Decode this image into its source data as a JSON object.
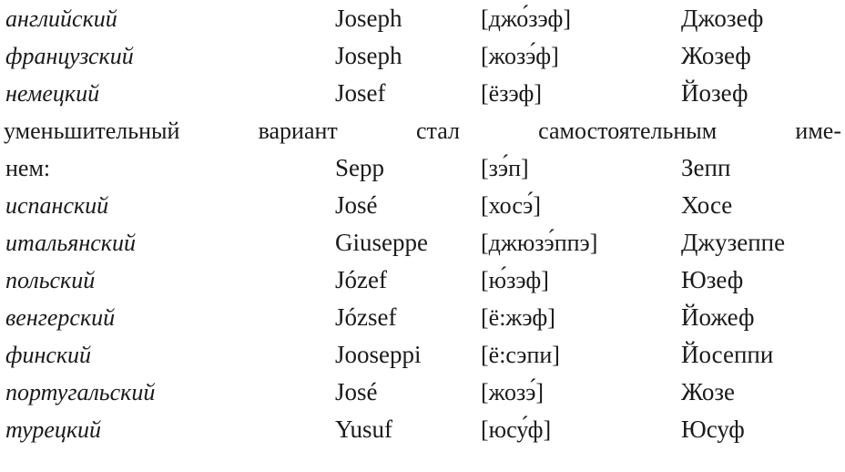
{
  "page": {
    "background_color": "#ffffff",
    "text_color": "#1a1a1a",
    "kind": "printed-page-fragment",
    "columns": [
      "language",
      "original_spelling",
      "transcription",
      "cyrillic_rendering"
    ]
  },
  "note": {
    "line1": "уменьшительный вариант стал самостоятельным име-",
    "line2_label": "нем:",
    "original": "Sepp",
    "transcription": "[зэ́п]",
    "cyrillic": "Зепп"
  },
  "rows_top": [
    {
      "language": "английский",
      "original": "Joseph",
      "transcription": "[джо́зэф]",
      "cyrillic": "Джозеф"
    },
    {
      "language": "французский",
      "original": "Joseph",
      "transcription": "[жозэ́ф]",
      "cyrillic": "Жозеф"
    },
    {
      "language": "немецкий",
      "original": "Josef",
      "transcription": "[ёзэф]",
      "cyrillic": "Йозеф"
    }
  ],
  "rows_bottom": [
    {
      "language": "испанский",
      "original": "José",
      "transcription": "[хосэ́]",
      "cyrillic": "Хосе"
    },
    {
      "language": "итальянский",
      "original": "Giuseppe",
      "transcription": "[джюзэ́ппэ]",
      "cyrillic": "Джузеппе"
    },
    {
      "language": "польский",
      "original": "Józef",
      "transcription": "[ю́зэф]",
      "cyrillic": "Юзеф"
    },
    {
      "language": "венгерский",
      "original": "József",
      "transcription": "[ё:жэф]",
      "cyrillic": "Йожеф"
    },
    {
      "language": "финский",
      "original": "Jooseppi",
      "transcription": "[ё:сэпи]",
      "cyrillic": "Йосеппи"
    },
    {
      "language": "португальский",
      "original": "José",
      "transcription": "[жозэ́]",
      "cyrillic": "Жозе"
    },
    {
      "language": "турецкий",
      "original": "Yusuf",
      "transcription": "[юсу́ф]",
      "cyrillic": "Юсуф"
    }
  ]
}
